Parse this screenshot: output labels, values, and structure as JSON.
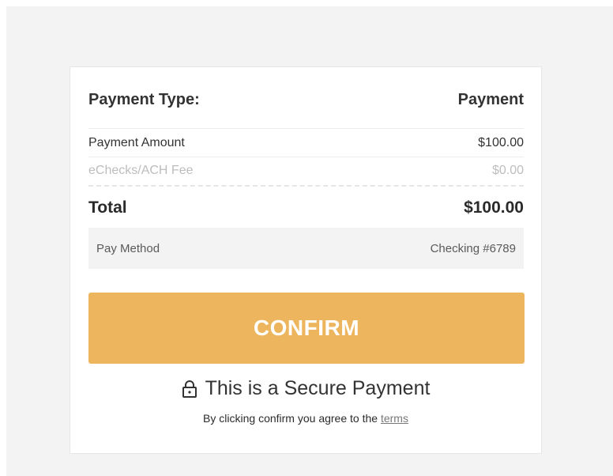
{
  "payment_type": {
    "label": "Payment Type:",
    "value": "Payment"
  },
  "line_items": [
    {
      "label": "Payment Amount",
      "value": "$100.00"
    },
    {
      "label": "eChecks/ACH Fee",
      "value": "$0.00"
    }
  ],
  "total": {
    "label": "Total",
    "value": "$100.00"
  },
  "pay_method": {
    "label": "Pay Method",
    "value": "Checking #6789"
  },
  "confirm_button": {
    "label": "CONFIRM",
    "color": "#edb65e"
  },
  "secure_notice": {
    "icon": "lock-icon",
    "text": "This is a Secure Payment"
  },
  "agreement": {
    "text": "By clicking confirm you agree to the ",
    "link_text": "terms"
  }
}
